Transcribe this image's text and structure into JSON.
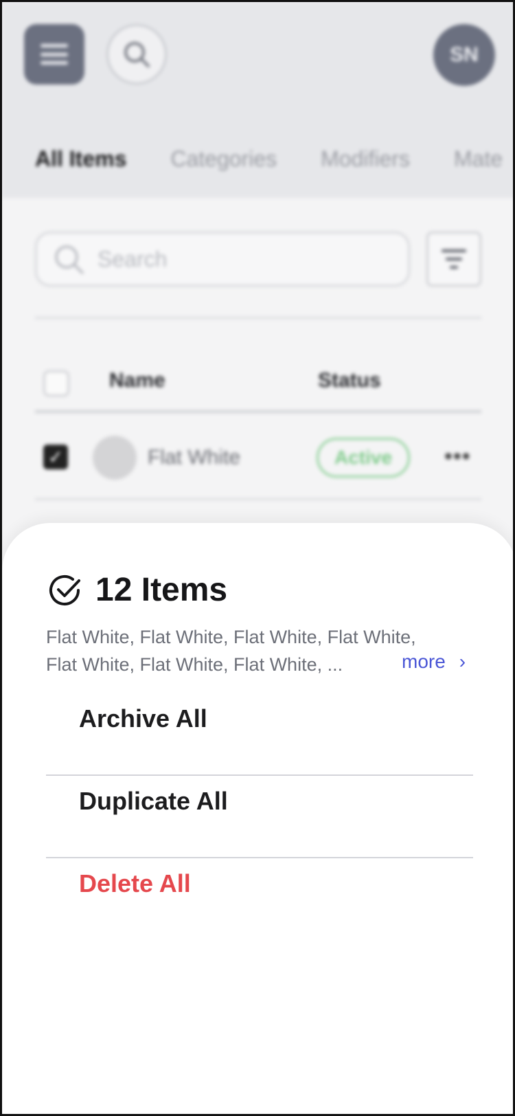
{
  "header": {
    "menu_icon": "hamburger-menu-icon",
    "search_icon": "search-icon",
    "avatar_initials": "SN"
  },
  "tabs": [
    {
      "label": "All Items",
      "active": true
    },
    {
      "label": "Categories",
      "active": false
    },
    {
      "label": "Modifiers",
      "active": false
    },
    {
      "label": "Mate",
      "active": false
    }
  ],
  "search": {
    "placeholder": "Search"
  },
  "table": {
    "columns": [
      "Name",
      "Status"
    ],
    "rows": [
      {
        "name": "Flat White",
        "status": "Active",
        "checked": true
      }
    ]
  },
  "sheet": {
    "title": "12 Items",
    "description_lines": [
      "Flat White, Flat White, Flat White, Flat White,",
      "Flat White, Flat White, Flat White,  ..."
    ],
    "more_label": "more",
    "actions": {
      "archive": "Archive All",
      "duplicate": "Duplicate All",
      "delete": "Delete All"
    }
  },
  "colors": {
    "accent": "#4a56d6",
    "danger": "#e5484d",
    "status_active": "#7fcb8b",
    "avatar_bg": "#6b7080"
  }
}
